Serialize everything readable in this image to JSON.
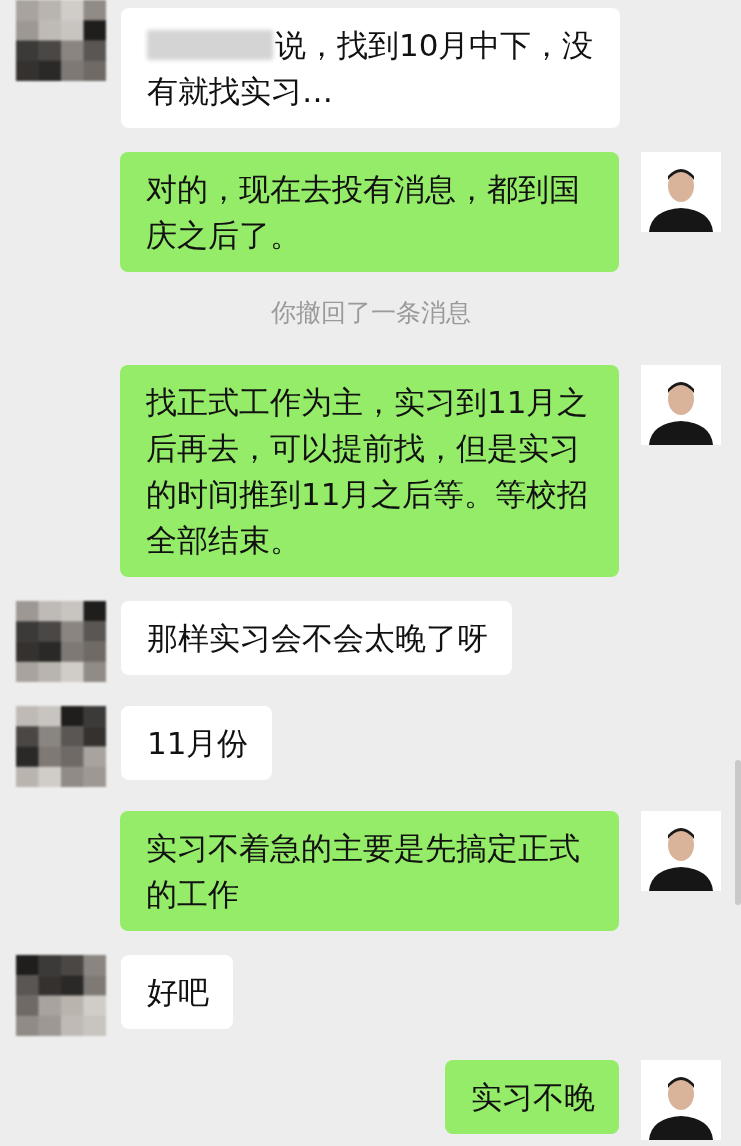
{
  "messages": [
    {
      "kind": "in",
      "redacted": true,
      "text": "说，找到10月中下，没有就找实习…"
    },
    {
      "kind": "out",
      "text": "对的，现在去投有消息，都到国庆之后了。"
    },
    {
      "kind": "notice",
      "text": "你撤回了一条消息"
    },
    {
      "kind": "out",
      "text": "找正式工作为主，实习到11月之后再去，可以提前找，但是实习的时间推到11月之后等。等校招全部结束。"
    },
    {
      "kind": "in",
      "text": "那样实习会不会太晚了呀"
    },
    {
      "kind": "in",
      "text": "11月份"
    },
    {
      "kind": "out",
      "text": "实习不着急的主要是先搞定正式的工作"
    },
    {
      "kind": "in",
      "text": "好吧"
    },
    {
      "kind": "out",
      "text": "实习不晚"
    }
  ]
}
